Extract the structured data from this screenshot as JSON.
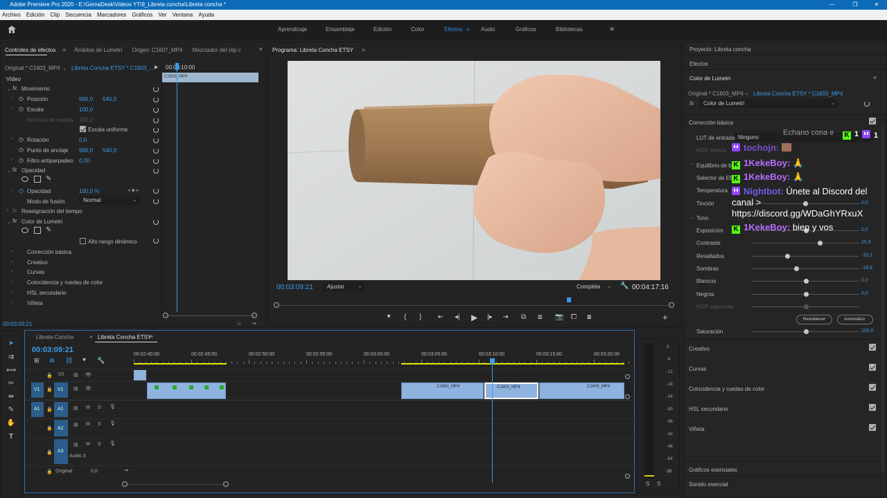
{
  "titlebar": {
    "title": "Adobe Premiere Pro 2020 - E:\\GemaDesk\\Videos YT\\9_Libreta concha\\Libreta concha *",
    "minimize": "—",
    "maximize": "❐",
    "close": "✕"
  },
  "menu": [
    "Archivo",
    "Edición",
    "Clip",
    "Secuencia",
    "Marcadores",
    "Gráficos",
    "Ver",
    "Ventana",
    "Ayuda"
  ],
  "workspaces": {
    "items": [
      "Aprendizaje",
      "Ensamblaje",
      "Edición",
      "Color",
      "Efectos",
      "Audio",
      "Gráficos",
      "Bibliotecas"
    ],
    "active": "Efectos",
    "more": "»"
  },
  "effect_controls": {
    "tabs": [
      "Controles de efectos",
      "Ámbitos de Lumetri",
      "Origen: C1607_MP4",
      "Mezclador del clip c"
    ],
    "source": "Original * C1603_MP4",
    "sequence": "Libreta Concha ETSY * C1603_...",
    "timecode": "00:03:10:00",
    "clip_label": "C1603_MP4",
    "video_label": "Vídeo",
    "movement": "Movimiento",
    "position": {
      "label": "Posición",
      "x": "960,0",
      "y": "540,0"
    },
    "scale": {
      "label": "Escala",
      "value": "100,0"
    },
    "scale_width": {
      "label": "Anchura de escala",
      "value": "100,0"
    },
    "uniform_scale": "Escala uniforme",
    "rotation": {
      "label": "Rotación",
      "value": "0,0"
    },
    "anchor": {
      "label": "Punto de anclaje",
      "x": "960,0",
      "y": "540,0"
    },
    "antiflicker": {
      "label": "Filtro antiparpadeo",
      "value": "0,00"
    },
    "opacity_group": "Opacidad",
    "opacity": {
      "label": "Opacidad",
      "value": "100,0 %"
    },
    "blend": {
      "label": "Modo de fusión",
      "value": "Normal"
    },
    "time_remap": "Reasignación del tiempo",
    "lumetri": "Color de Lumetri",
    "hdr": "Alto rango dinámico",
    "sections": [
      "Corrección básica",
      "Creativo",
      "Curvas",
      "Coincidencia y ruedas de color",
      "HSL secundario",
      "Viñeta"
    ],
    "current_time": "00:03:09:21"
  },
  "program": {
    "tab": "Programa: Libreta Concha ETSY",
    "timecode": "00:03:09:21",
    "fit": "Ajustar",
    "quality": "Completa",
    "duration": "00:04:17:16",
    "playhead_fraction": 0.74
  },
  "lumetri": {
    "project": "Proyecto: Libreta concha",
    "effects": "Efectos",
    "title": "Color de Lumetri",
    "source": "Original * C1603_MP4",
    "sequence": "Libreta Concha ETSY * C1603_MP4",
    "fx": "Color de Lumetri",
    "basic": "Corrección básica",
    "lut_label": "LUT de entrada",
    "lut_value": "Ninguno",
    "hdr_white": "HDR blanco",
    "wb": "Equilibrio de bl",
    "wb_selector": "Selector de EB",
    "temperature": "Temperatura",
    "tint": "Tinción",
    "tint_value": "0,0",
    "tone": "Tono",
    "rows": [
      {
        "label": "Exposición",
        "value": "0,0",
        "pos": 0.5
      },
      {
        "label": "Contraste",
        "value": "25,6",
        "pos": 0.63
      },
      {
        "label": "Resaltados",
        "value": "-33,3",
        "pos": 0.33
      },
      {
        "label": "Sombras",
        "value": "-18,9",
        "pos": 0.41
      },
      {
        "label": "Blancos",
        "value": "0,0",
        "pos": 0.5
      },
      {
        "label": "Negros",
        "value": "0,0",
        "pos": 0.5
      },
      {
        "label": "HDR especular",
        "value": "",
        "pos": 0.5
      }
    ],
    "reset": "Restablecer",
    "auto": "Automático",
    "saturation": {
      "label": "Saturación",
      "value": "100,0",
      "pos": 0.5
    },
    "sections": [
      "Creativo",
      "Curvas",
      "Coincidencia y ruedas de color",
      "HSL secundario",
      "Viñeta"
    ],
    "bottom": [
      "Gráficos esenciales",
      "Sonido esencial"
    ]
  },
  "chat": {
    "header": "Echano cona e",
    "kick_count": "1",
    "twitch_count": "1",
    "messages": [
      {
        "platform": "twitch",
        "user": "tochojn:",
        "text": "",
        "user_color": "#9b5cf0"
      },
      {
        "platform": "kick",
        "user": "1KekeBoy:",
        "text": "🙏",
        "user_color": "#b66cff"
      },
      {
        "platform": "kick",
        "user": "1KekeBoy:",
        "text": "🙏",
        "user_color": "#b66cff"
      },
      {
        "platform": "twitch",
        "user": "Nightbot:",
        "text": "Únete al Discord del canal > https://discord.gg/WDaGhYRxuX",
        "user_color": "#7c6cf0"
      },
      {
        "platform": "kick",
        "user": "1KekeBoy:",
        "text": "bien y vos",
        "user_color": "#b66cff"
      }
    ]
  },
  "timeline": {
    "tabs": [
      "Libreta Concha",
      "Libreta Concha ETSY"
    ],
    "active_tab": "Libreta Concha ETSY",
    "timecode": "00:03:09:21",
    "ruler": [
      "00:02:40:00",
      "00:02:45:00",
      "00:02:50:00",
      "00:02:55:00",
      "00:03:00:00",
      "00:03:05:00",
      "00:03:10:00",
      "00:03:15:00",
      "00:03:20:00"
    ],
    "tracks": [
      {
        "id": "V2",
        "label": "V2"
      },
      {
        "id": "V1",
        "label": "V1",
        "src": "V1"
      },
      {
        "id": "A1",
        "label": "A1",
        "src": "A1"
      },
      {
        "id": "A2",
        "label": "A2"
      },
      {
        "id": "A3",
        "label": "A3",
        "name": "Audio 3"
      }
    ],
    "clips": [
      "C1602_MP4",
      "C1603_MP4",
      "C1606_MP4"
    ],
    "master": {
      "label": "Original",
      "value": "0,0"
    },
    "meter_scale": [
      "0",
      "-6",
      "-12",
      "-18",
      "-24",
      "-30",
      "-36",
      "-42",
      "-48",
      "-54",
      "dB"
    ],
    "solo": "S"
  },
  "colors": {
    "accent": "#2d8ceb",
    "titlebar": "#0c6bb8",
    "clip": "#8fb3df",
    "kick": "#53fc18",
    "twitch": "#9146ff"
  }
}
